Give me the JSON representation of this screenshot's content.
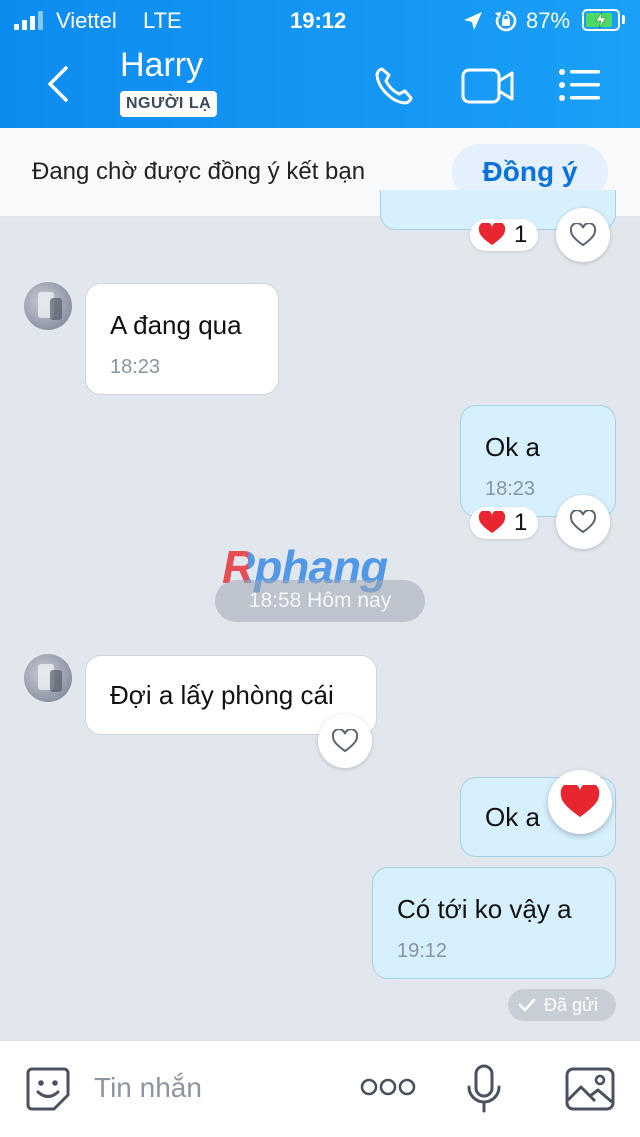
{
  "status_bar": {
    "carrier": "Viettel",
    "network": "LTE",
    "time": "19:12",
    "battery_percent": "87%",
    "battery_level": 0.87
  },
  "header": {
    "contact_name": "Harry",
    "badge": "NGƯỜI LẠ",
    "icons": [
      "back-chevron-icon",
      "phone-icon",
      "video-call-icon",
      "menu-list-icon"
    ]
  },
  "friend_request": {
    "text": "Đang chờ được đồng ý kết bạn",
    "accept_label": "Đồng ý"
  },
  "messages": [
    {
      "direction": "out",
      "text": "",
      "reaction_count": "1",
      "partial": true
    },
    {
      "direction": "in",
      "text": "A đang qua",
      "time": "18:23"
    },
    {
      "direction": "out",
      "text": "Ok a",
      "time": "18:23",
      "reaction_count": "1"
    },
    {
      "direction": "in",
      "text": "Đợi a lấy phòng cái"
    },
    {
      "direction": "out",
      "text": "Ok a",
      "reaction": "heart"
    },
    {
      "direction": "out",
      "text": "Có tới ko vậy a",
      "time": "19:12"
    }
  ],
  "date_separator": "18:58 Hôm nay",
  "watermark": "Rphang",
  "sent_status": "Đã gửi",
  "composer": {
    "placeholder": "Tin nhắn",
    "icons": [
      "sticker-icon",
      "more-icon",
      "microphone-icon",
      "image-icon"
    ]
  },
  "colors": {
    "header_gradient_start": "#0d8cf0",
    "header_gradient_end": "#1aa0f7",
    "chat_background": "#e2e7ee",
    "outgoing_bubble": "#d6f0fd",
    "incoming_bubble": "#ffffff",
    "accent": "#0a72db",
    "heart": "#e8262f"
  }
}
